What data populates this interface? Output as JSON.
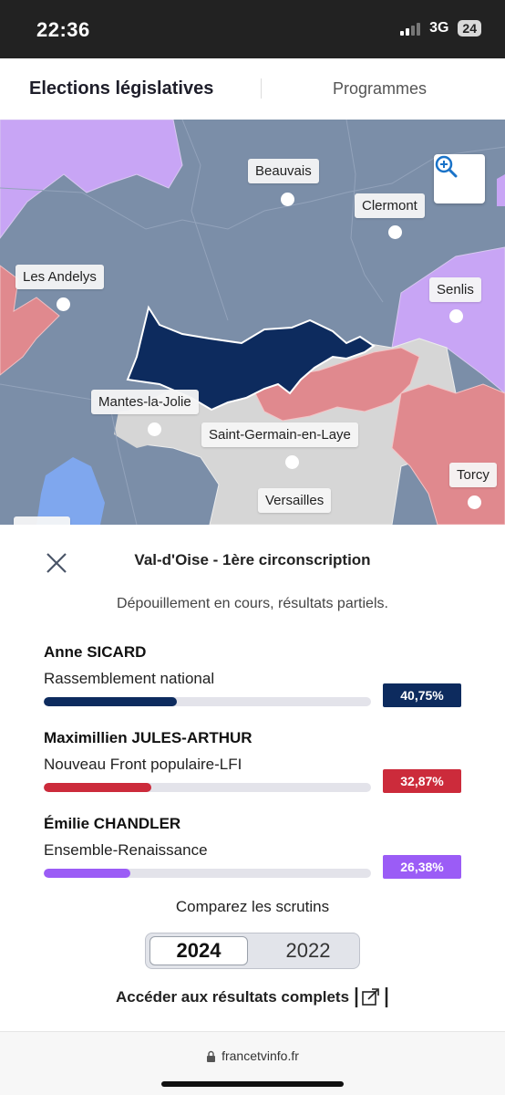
{
  "status_bar": {
    "time": "22:36",
    "network": "3G",
    "battery": "24"
  },
  "header": {
    "tabs": [
      {
        "label": "Elections législatives",
        "active": true
      },
      {
        "label": "Programmes",
        "active": false
      }
    ]
  },
  "map": {
    "cities": [
      {
        "name": "Beauvais"
      },
      {
        "name": "Clermont"
      },
      {
        "name": "Les Andelys"
      },
      {
        "name": "Senlis"
      },
      {
        "name": "Mantes-la-Jolie"
      },
      {
        "name": "Saint-Germain-en-Laye"
      },
      {
        "name": "Torcy"
      },
      {
        "name": "Versailles"
      }
    ],
    "zoom_icon": "zoom-in-icon",
    "colors": {
      "background": "#7b8ea8",
      "highlight": "#0d2b5e",
      "rn": "#0d2b5e",
      "nfp": "#e0898e",
      "ensemble": "#c8a5f5",
      "other": "#d9d9d9"
    }
  },
  "panel": {
    "close_icon": "close-icon",
    "title": "Val-d'Oise - 1ère circonscription",
    "subtitle": "Dépouillement en cours, résultats partiels.",
    "candidates": [
      {
        "name": "Anne SICARD",
        "party": "Rassemblement national",
        "percent_label": "40,75%",
        "percent": 40.75,
        "color": "#0d2b5e"
      },
      {
        "name": "Maximillien JULES-ARTHUR",
        "party": "Nouveau Front populaire-LFI",
        "percent_label": "32,87%",
        "percent": 32.87,
        "color": "#cc2b3b"
      },
      {
        "name": "Émilie CHANDLER",
        "party": "Ensemble-Renaissance",
        "percent_label": "26,38%",
        "percent": 26.38,
        "color": "#9b5cf6"
      }
    ],
    "compare_label": "Comparez les scrutins",
    "years": [
      {
        "label": "2024",
        "selected": true
      },
      {
        "label": "2022",
        "selected": false
      }
    ],
    "full_results_label": "Accéder aux résultats complets",
    "external_icon": "external-link-icon"
  },
  "browser": {
    "url": "francetvinfo.fr",
    "lock_icon": "lock-icon"
  }
}
